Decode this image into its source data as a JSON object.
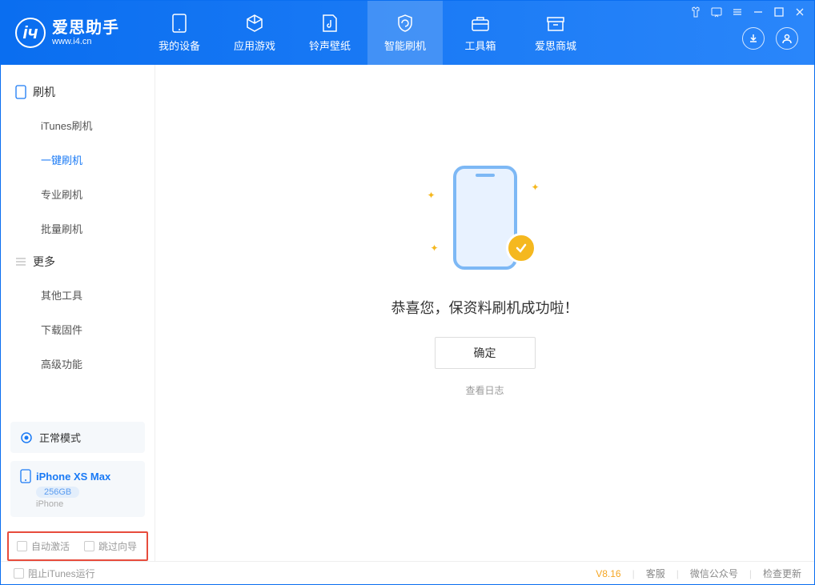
{
  "app": {
    "name_cn": "爱思助手",
    "name_en": "www.i4.cn"
  },
  "tabs": [
    {
      "label": "我的设备"
    },
    {
      "label": "应用游戏"
    },
    {
      "label": "铃声壁纸"
    },
    {
      "label": "智能刷机"
    },
    {
      "label": "工具箱"
    },
    {
      "label": "爱思商城"
    }
  ],
  "sidebar": {
    "section1": {
      "title": "刷机",
      "items": [
        "iTunes刷机",
        "一键刷机",
        "专业刷机",
        "批量刷机"
      ]
    },
    "section2": {
      "title": "更多",
      "items": [
        "其他工具",
        "下载固件",
        "高级功能"
      ]
    }
  },
  "mode": "正常模式",
  "device": {
    "name": "iPhone XS Max",
    "capacity": "256GB",
    "type": "iPhone"
  },
  "checkboxes": {
    "auto_activate": "自动激活",
    "skip_guide": "跳过向导"
  },
  "main": {
    "success_text": "恭喜您，保资料刷机成功啦！",
    "ok_button": "确定",
    "view_log": "查看日志"
  },
  "footer": {
    "block_itunes": "阻止iTunes运行",
    "version": "V8.16",
    "support": "客服",
    "wechat": "微信公众号",
    "check_update": "检查更新"
  }
}
